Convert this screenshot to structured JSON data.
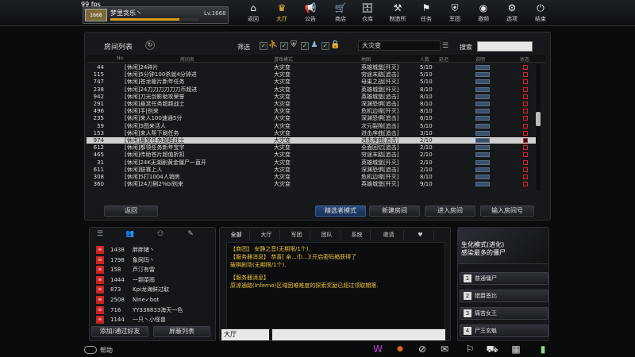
{
  "fps": "99 fps",
  "profile": {
    "avatar_label": "1668",
    "name": "梦里贪乐丶",
    "level": "Lv.1668",
    "exp_fraction": 0.78
  },
  "nav": [
    {
      "label": "返回",
      "icon": "home-icon",
      "glyph": "⌂"
    },
    {
      "label": "大厅",
      "icon": "lobby-icon",
      "glyph": "♛"
    },
    {
      "label": "公告",
      "icon": "megaphone-icon",
      "glyph": "📢"
    },
    {
      "label": "商店",
      "icon": "shop-icon",
      "glyph": "🛒"
    },
    {
      "label": "仓库",
      "icon": "warehouse-icon",
      "glyph": "🗄"
    },
    {
      "label": "制造所",
      "icon": "craft-icon",
      "glyph": "⚒"
    },
    {
      "label": "任务",
      "icon": "mission-icon",
      "glyph": "⚑"
    },
    {
      "label": "军团",
      "icon": "clan-icon",
      "glyph": "⛨"
    },
    {
      "label": "邀频",
      "icon": "invite-icon",
      "glyph": "◉"
    },
    {
      "label": "选项",
      "icon": "settings-icon",
      "glyph": "⚙"
    },
    {
      "label": "结束",
      "icon": "power-icon",
      "glyph": "⏻"
    }
  ],
  "room_panel": {
    "title": "房间列表",
    "filter_label": "筛选",
    "mode_value": "大灾变",
    "search_label": "搜索",
    "search_value": "",
    "headers": [
      "No",
      "房间名",
      "游戏模式",
      "地图",
      "人数",
      "延迟",
      "说明",
      "状态"
    ],
    "rows": [
      {
        "no": "44",
        "name": "[休闲]24碎片",
        "mode": "大灾变",
        "map": "英雄城堡[歼灭]",
        "count": "5/10"
      },
      {
        "no": "115",
        "name": "[休闲]5分钟100杀就4分钟进",
        "mode": "大灾变",
        "map": "穷途末路[追击]",
        "count": "5/10"
      },
      {
        "no": "747",
        "name": "[休闲]苍龙躯片新年任务",
        "mode": "大灾变",
        "map": "母巢之战[歼灭]",
        "count": "5/10"
      },
      {
        "no": "238",
        "name": "[休闲]24刀刀刀刀刀刀币超进",
        "mode": "大灾变",
        "map": "英雄城堡[歼灭]",
        "count": "8/10"
      },
      {
        "no": "942",
        "name": "[休闲]刀光剑影助攻荣誉",
        "mode": "大灾变",
        "map": "英雄城堡[追击]",
        "count": "8/10"
      },
      {
        "no": "291",
        "name": "[休闲]悬赏任务超越战士",
        "mode": "大灾变",
        "map": "深渊恐惧[追击]",
        "count": "8/10"
      },
      {
        "no": "496",
        "name": "[休闲]手|别来",
        "mode": "大灾变",
        "map": "危机边缘[歼灭]",
        "count": "8/10"
      },
      {
        "no": "235",
        "name": "[休闲]来人100速通5分",
        "mode": "大灾变",
        "map": "深渊恐惧[追击]",
        "count": "6/10"
      },
      {
        "no": "59",
        "name": "[休闲]5图来活人",
        "mode": "大灾变",
        "map": "次元裂隙[追击]",
        "count": "5/10"
      },
      {
        "no": "153",
        "name": "[休闲]来人帮下刷任务",
        "mode": "大灾变",
        "map": "进击序曲[追击]",
        "count": "3/10"
      },
      {
        "no": "974",
        "name": "[休闲]悬赏任务超越战士",
        "mode": "大灾变",
        "map": "进击序曲[追击]",
        "count": "2/10"
      },
      {
        "no": "612",
        "name": "[休闲]都领任务新年宝宇",
        "mode": "大灾变",
        "map": "全面回忆[追击]",
        "count": "2/10"
      },
      {
        "no": "465",
        "name": "[休闲]传助苍片超值折扣",
        "mode": "大灾变",
        "map": "穷途末路[追击]",
        "count": "2/10"
      },
      {
        "no": "31",
        "name": "[休闲]24K无湖剧黄金僵尸一直开",
        "mode": "大灾变",
        "map": "英雄城堡[歼灭]",
        "count": "2/10"
      },
      {
        "no": "611",
        "name": "[休闲]联赛上人",
        "mode": "大灾变",
        "map": "深渊恐惧[追击]",
        "count": "2/10"
      },
      {
        "no": "308",
        "name": "[休闲]5打1004人销房",
        "mode": "大灾变",
        "map": "危机边缘[歼灭]",
        "count": "8/10"
      },
      {
        "no": "360",
        "name": "[休闲]24刀剧2%bi别来",
        "mode": "大灾变",
        "map": "英雄城堡[歼灭]",
        "count": "9/10"
      }
    ],
    "selected_no": "974",
    "buttons": {
      "back": "返回",
      "observer": "精选者模式",
      "create": "新建房间",
      "enter": "进入房间",
      "enter_by_no": "输入房间号"
    }
  },
  "friends": {
    "tabs_icons": [
      "list-icon",
      "friends-icon",
      "group-icon",
      "edit-icon"
    ],
    "items": [
      {
        "lv": "1438",
        "name": "胖胖猪丶"
      },
      {
        "lv": "1798",
        "name": "象网玛丶"
      },
      {
        "lv": "158",
        "name": "芦汀有雷"
      },
      {
        "lv": "1444",
        "name": "一颗菜雨"
      },
      {
        "lv": "873",
        "name": "Kpi龙海鲜过取"
      },
      {
        "lv": "2508",
        "name": "Nine✓bot"
      },
      {
        "lv": "716",
        "name": "YY338833海天一色"
      },
      {
        "lv": "1144",
        "name": "一只丶小怪兽"
      }
    ],
    "btn_add": "添加/通过好友",
    "btn_block": "屏蔽列表"
  },
  "chat": {
    "tabs": [
      "全部",
      "大厅",
      "军团",
      "团队",
      "系统",
      "邀请",
      "♥"
    ],
    "lines": [
      {
        "text": "【商团】 安静之音(无期限/1个).",
        "color": "#e9c23a"
      },
      {
        "text": "【服务器消息】 恭喜[ 亲...巾...]!开启密码箱获得了",
        "color": "#e9c23a"
      },
      {
        "text": "破棋剧场(无期限/1个).",
        "color": "#e9c23a"
      },
      {
        "text": "【服务器消息】",
        "color": "#e9c23a"
      },
      {
        "text": "原谅通路(Inferno)区域困难难度的探索奖励已超过领取期限.",
        "color": "#e9c23a"
      }
    ],
    "channel": "大厅",
    "input_value": ""
  },
  "mode_banner": {
    "title": "生化模式(进化)",
    "subtitle": "感染最多的僵尸"
  },
  "zombie_list": [
    {
      "num": "1",
      "label": "普通僵尸"
    },
    {
      "num": "2",
      "label": "猎爵恩比"
    },
    {
      "num": "3",
      "label": "痛苦女王"
    },
    {
      "num": "4",
      "label": "尸王玄魁"
    }
  ],
  "help_label": "帮助",
  "bottom_icons": [
    "weapon-icon",
    "fire-icon",
    "compass-icon",
    "gift-icon",
    "flag-icon",
    "cart-icon",
    "calendar-icon",
    "battery-icon"
  ]
}
